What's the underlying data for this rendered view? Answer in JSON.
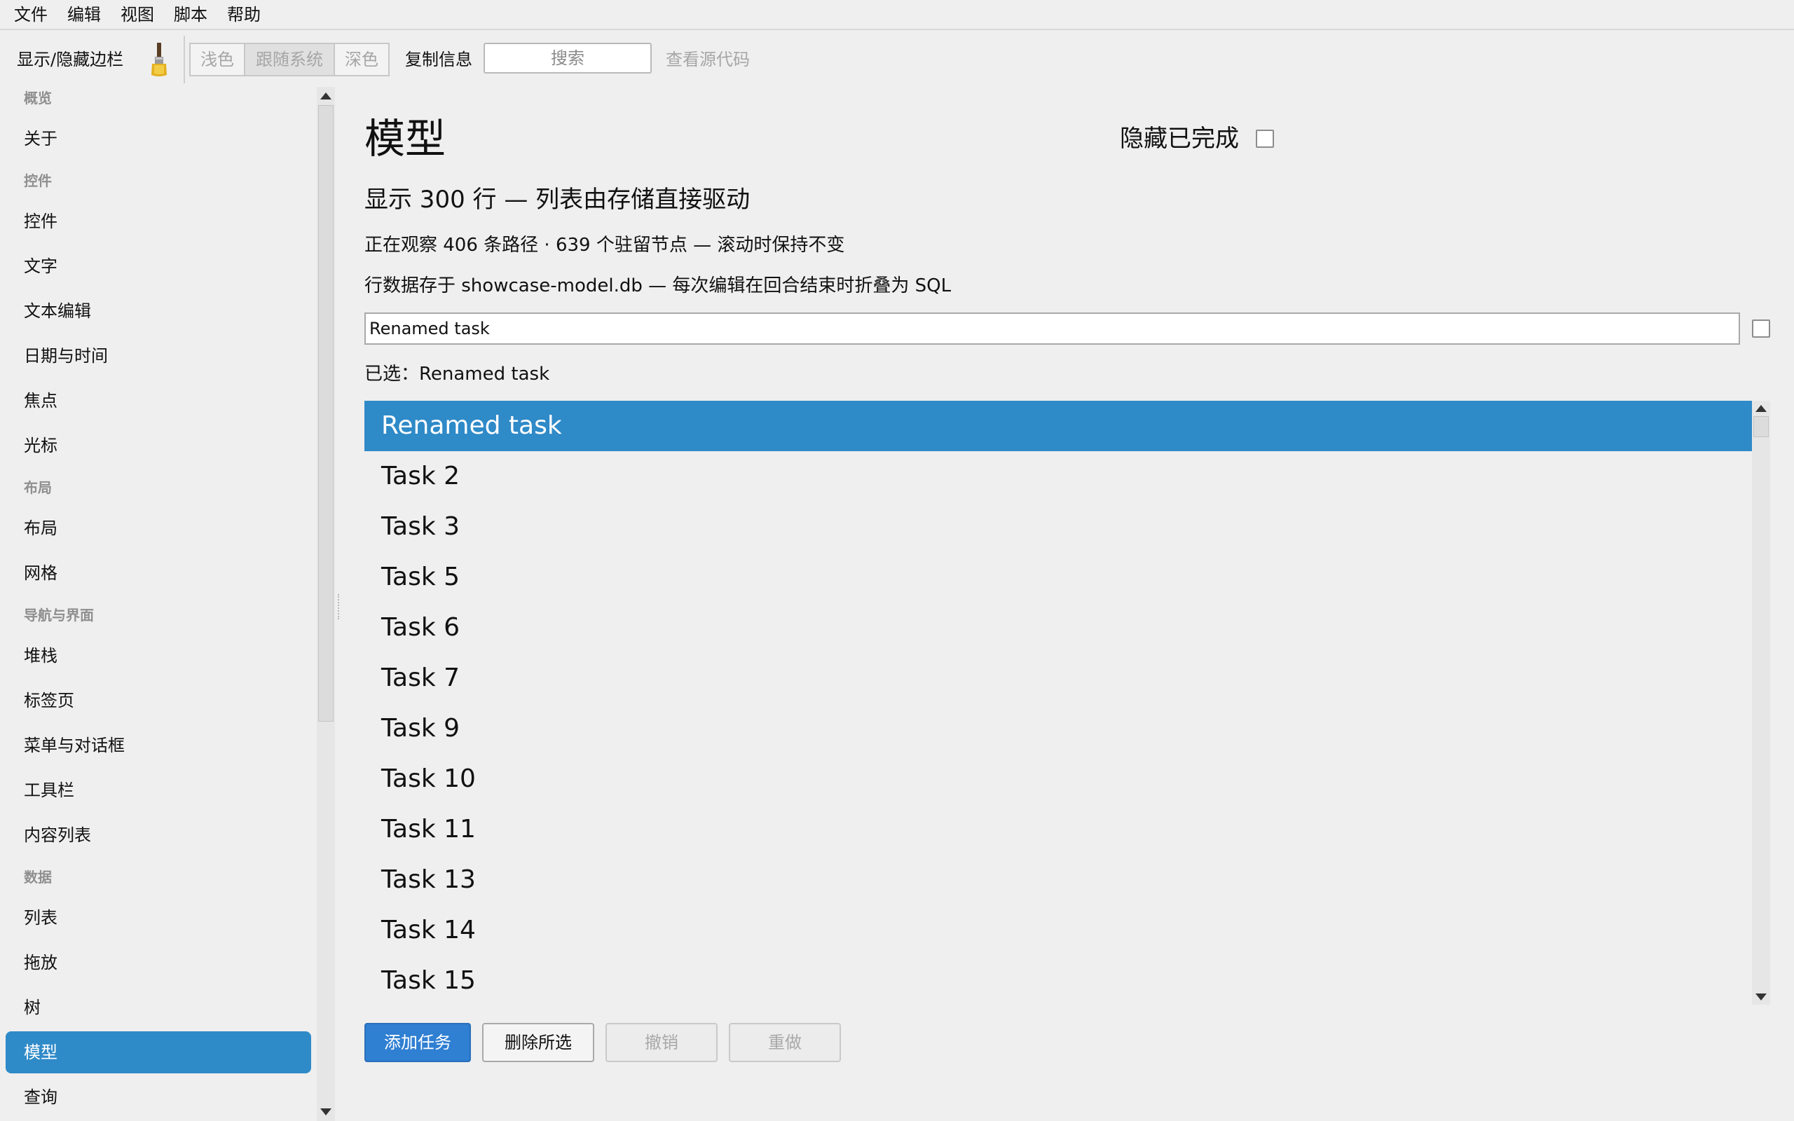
{
  "menu": [
    "文件",
    "编辑",
    "视图",
    "脚本",
    "帮助"
  ],
  "toolbar": {
    "toggle_sidebar": "显示/隐藏边栏",
    "brush_icon": "paintbrush-icon",
    "theme_light": "浅色",
    "theme_system": "跟随系统",
    "theme_dark": "深色",
    "copy_info": "复制信息",
    "search_placeholder": "搜索",
    "view_source": "查看源代码"
  },
  "sidebar": {
    "sections": [
      {
        "title": "概览",
        "items": [
          "关于"
        ]
      },
      {
        "title": "控件",
        "items": [
          "控件",
          "文字",
          "文本编辑",
          "日期与时间",
          "焦点",
          "光标"
        ]
      },
      {
        "title": "布局",
        "items": [
          "布局",
          "网格"
        ]
      },
      {
        "title": "导航与界面",
        "items": [
          "堆栈",
          "标签页",
          "菜单与对话框",
          "工具栏",
          "内容列表"
        ]
      },
      {
        "title": "数据",
        "items": [
          "列表",
          "拖放",
          "树",
          "模型",
          "查询"
        ]
      }
    ],
    "selected": "模型"
  },
  "main": {
    "title": "模型",
    "hide_completed_label": "隐藏已完成",
    "hide_completed_checked": false,
    "subtitle": "显示 300 行 — 列表由存储直接驱动",
    "observe_info": "正在观察 406 条路径 · 639 个驻留节点 — 滚动时保持不变",
    "db_info": "行数据存于 showcase-model.db — 每次编辑在回合结束时折叠为 SQL",
    "edit_value": "Renamed task",
    "edit_checked": false,
    "selected_label": "已选：Renamed task",
    "rows": [
      "Renamed task",
      "Task 2",
      "Task 3",
      "Task 5",
      "Task 6",
      "Task 7",
      "Task 9",
      "Task 10",
      "Task 11",
      "Task 13",
      "Task 14",
      "Task 15"
    ],
    "selected_row": 0,
    "buttons": {
      "add": "添加任务",
      "delete": "删除所选",
      "undo": "撤销",
      "redo": "重做"
    }
  },
  "colors": {
    "accent": "#2f8ac8",
    "primary_button": "#2f7fd2",
    "background": "#efefef"
  }
}
